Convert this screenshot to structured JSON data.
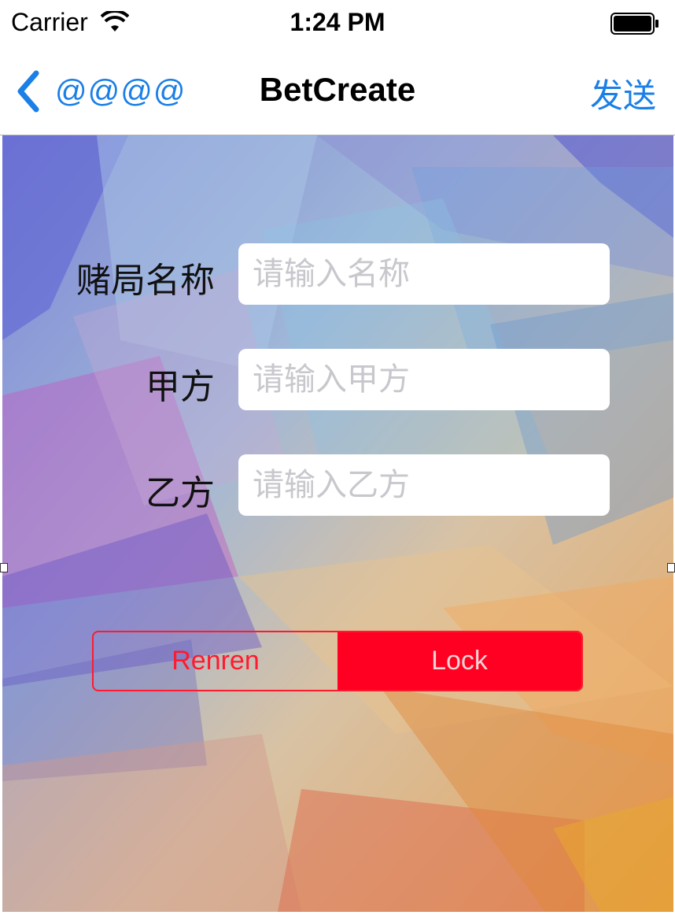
{
  "status_bar": {
    "carrier": "Carrier",
    "time": "1:24 PM",
    "wifi_icon": "wifi-icon",
    "battery_icon": "battery-icon"
  },
  "nav": {
    "back_label": "@@@@",
    "back_icon": "chevron-left-icon",
    "title": "BetCreate",
    "action_label": "发送",
    "tint_color": "#1a7fe6"
  },
  "form": {
    "name": {
      "label": "赌局名称",
      "placeholder": "请输入名称",
      "value": ""
    },
    "party_a": {
      "label": "甲方",
      "placeholder": "请输入甲方",
      "value": ""
    },
    "party_b": {
      "label": "乙方",
      "placeholder": "请输入乙方",
      "value": ""
    }
  },
  "segmented": {
    "options": [
      "Renren",
      "Lock"
    ],
    "selected": "Lock",
    "accent_color": "#ff0022"
  }
}
